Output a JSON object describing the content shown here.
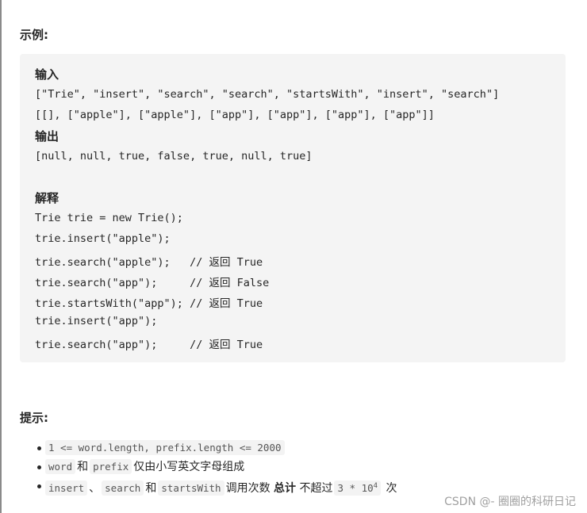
{
  "example_title": "示例:",
  "code": {
    "input_label": "输入",
    "input_lines": [
      "[\"Trie\", \"insert\", \"search\", \"search\", \"startsWith\", \"insert\", \"search\"]",
      "[[], [\"apple\"], [\"apple\"], [\"app\"], [\"app\"], [\"app\"], [\"app\"]]"
    ],
    "output_label": "输出",
    "output_line": "[null, null, true, false, true, null, true]",
    "explain_label": "解释",
    "explain_lines": [
      "Trie trie = new Trie();",
      "trie.insert(\"apple\");",
      "trie.search(\"apple\");   // 返回 True",
      "trie.search(\"app\");     // 返回 False",
      "trie.startsWith(\"app\"); // 返回 True",
      "trie.insert(\"app\");",
      "trie.search(\"app\");     // 返回 True"
    ]
  },
  "hint_title": "提示:",
  "hints": {
    "h1": "1 <= word.length, prefix.length <= 2000",
    "h2_a": "word",
    "h2_and": "和",
    "h2_b": "prefix",
    "h2_rest": "仅由小写英文字母组成",
    "h3_a": "insert",
    "h3_sep": "、",
    "h3_b": "search",
    "h3_and": "和",
    "h3_c": "startsWith",
    "h3_mid": "调用次数",
    "h3_bold": "总计",
    "h3_not": "不超过",
    "h3_num": "3 * 10",
    "h3_exp": "4",
    "h3_end": "次"
  },
  "watermark": "CSDN @- 圈圈的科研日记"
}
